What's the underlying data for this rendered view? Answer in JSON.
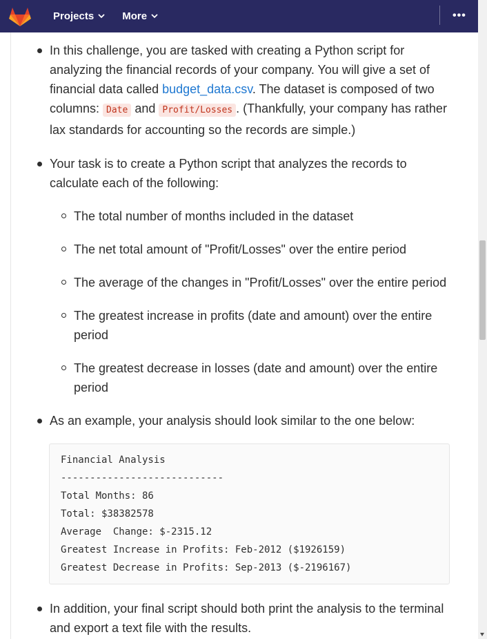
{
  "nav": {
    "projects_label": "Projects",
    "more_label": "More",
    "more_menu_glyph": "•••"
  },
  "content": {
    "bullet1": {
      "p1": "In this challenge, you are tasked with creating a Python script for analyzing the financial records of your company. You will give a set of financial data called ",
      "link": "budget_data.csv",
      "p2": ". The dataset is composed of two columns: ",
      "code1": "Date",
      "p3": " and ",
      "code2": "Profit/Losses",
      "p4": ". (Thankfully, your company has rather lax standards for accounting so the records are simple.)"
    },
    "bullet2": "Your task is to create a Python script that analyzes the records to calculate each of the following:",
    "sub_items": [
      "The total number of months included in the dataset",
      "The net total amount of \"Profit/Losses\" over the entire period",
      "The average of the changes in \"Profit/Losses\" over the entire period",
      "The greatest increase in profits (date and amount) over the entire period",
      "The greatest decrease in losses (date and amount) over the entire period"
    ],
    "bullet3": "As an example, your analysis should look similar to the one below:",
    "code_block": "Financial Analysis\n----------------------------\nTotal Months: 86\nTotal: $38382578\nAverage  Change: $-2315.12\nGreatest Increase in Profits: Feb-2012 ($1926159)\nGreatest Decrease in Profits: Sep-2013 ($-2196167)",
    "bullet4": "In addition, your final script should both print the analysis to the terminal and export a text file with the results."
  },
  "colors": {
    "navbar": "#292961",
    "link": "#1f78d1",
    "code_text": "#c0341d",
    "code_bg": "#fbe5e1"
  },
  "icons": {
    "logo": "gitlab-tanuki-logo",
    "chevron": "chevron-down-icon",
    "menu": "more-horizontal-icon"
  }
}
